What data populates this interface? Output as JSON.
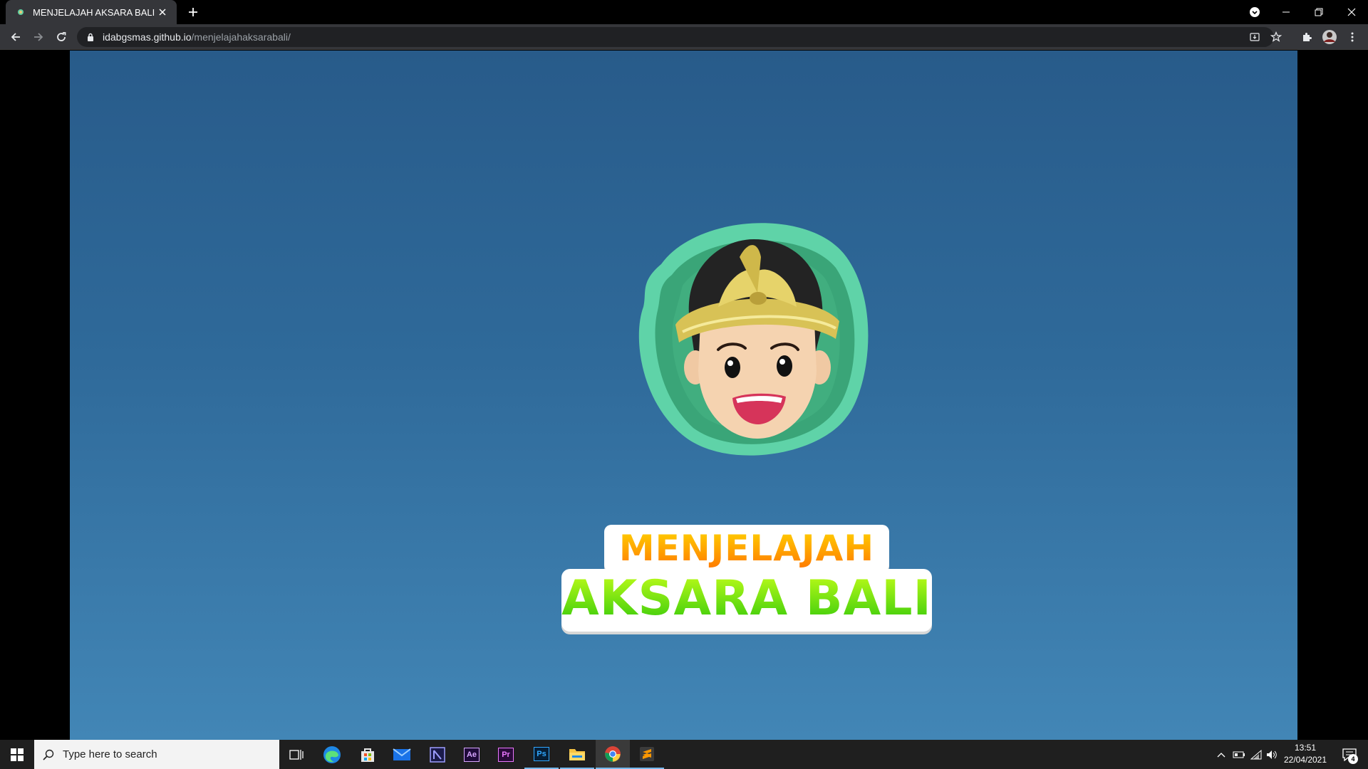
{
  "browser": {
    "tab_title": "MENJELAJAH AKSARA BALI",
    "url_host": "idabgsmas.github.io",
    "url_path": "/menjelajahaksarabali/"
  },
  "game": {
    "title_line1": "MENJELAJAH",
    "title_line2": "AKSARA BALI",
    "background_top": "#285b8a",
    "background_bottom": "#4286b6"
  },
  "taskbar": {
    "search_placeholder": "Type here to search",
    "apps": [
      "task-view-icon",
      "edge-icon",
      "store-icon",
      "mail-icon",
      "premiere-rush-icon",
      "after-effects-icon",
      "premiere-pro-icon",
      "photoshop-icon",
      "file-explorer-icon",
      "chrome-icon",
      "sublime-text-icon"
    ],
    "adobe_labels": {
      "ae": "Ae",
      "pr": "Pr",
      "ps": "Ps"
    },
    "time": "13:51",
    "date": "22/04/2021",
    "notification_count": "4"
  }
}
